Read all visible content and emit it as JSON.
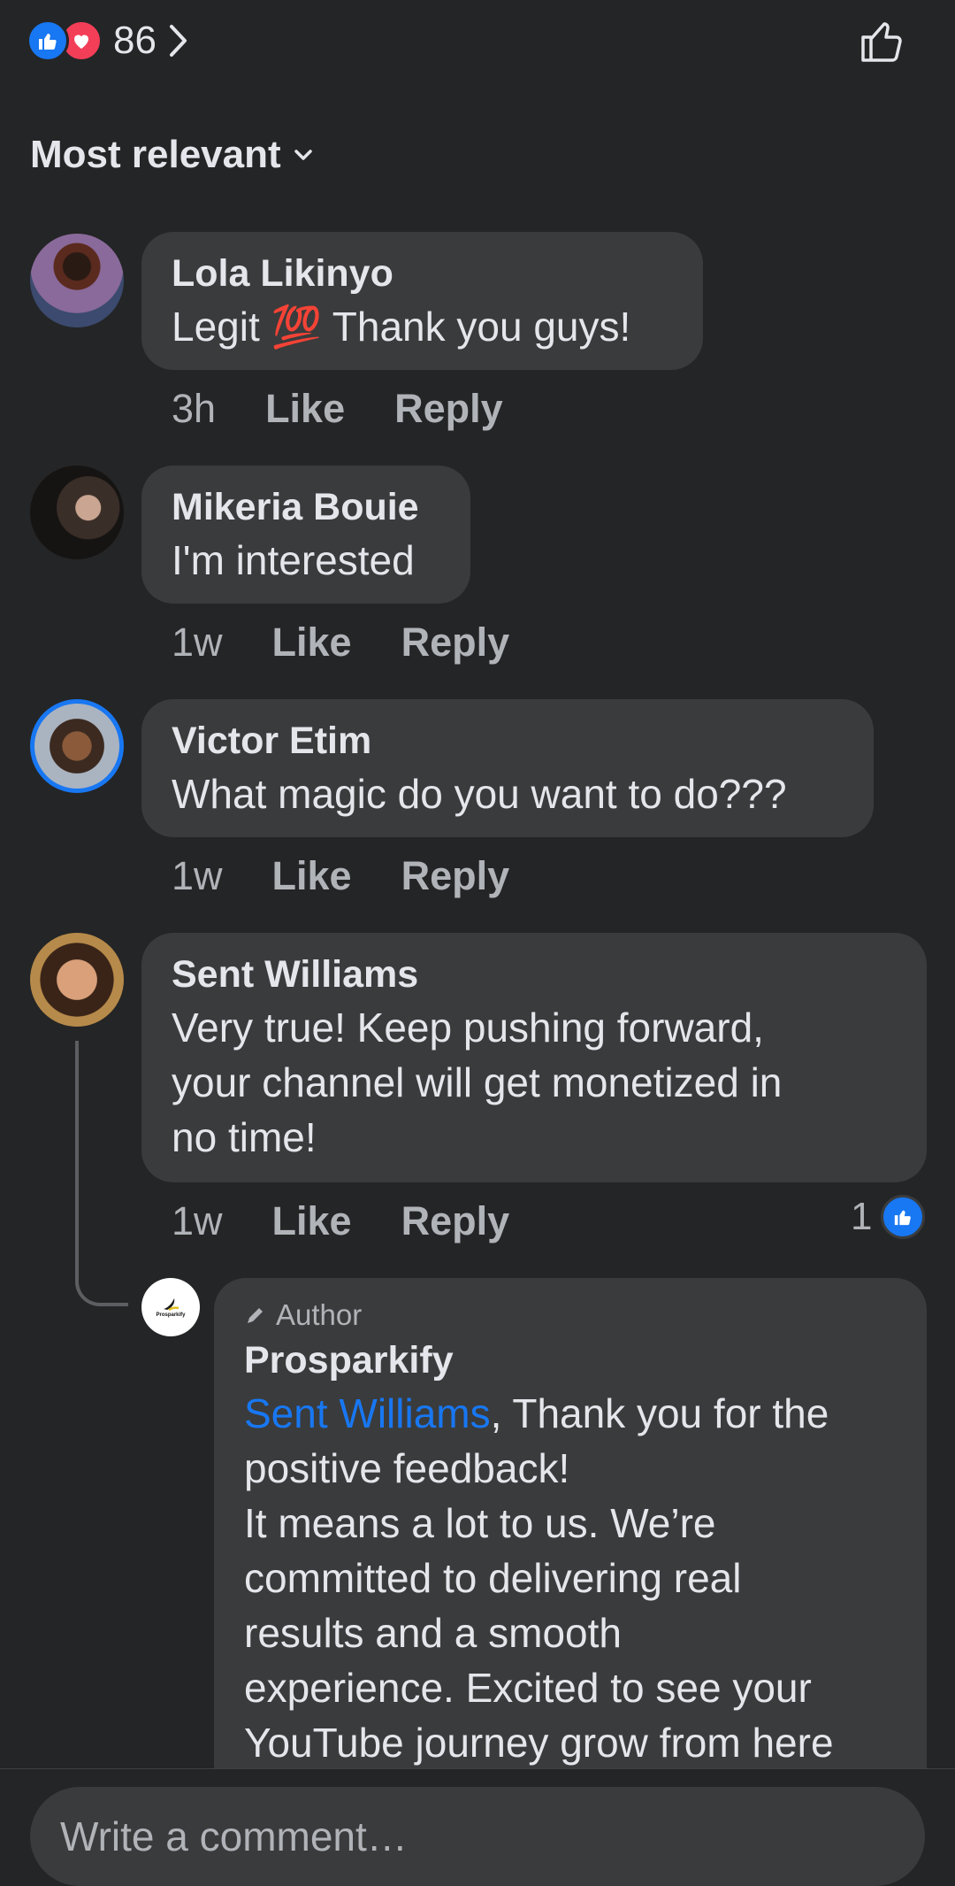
{
  "reactions": {
    "count": "86",
    "types": [
      "like",
      "love"
    ],
    "colors": {
      "like": "#1877f2",
      "love": "#f33e58"
    }
  },
  "sort": {
    "label": "Most relevant"
  },
  "comments": [
    {
      "name": "Lola Likinyo",
      "text_before": "Legit ",
      "emoji": "💯",
      "text_after": " Thank you guys!",
      "time": "3h",
      "like": "Like",
      "reply": "Reply"
    },
    {
      "name": "Mikeria Bouie",
      "text": "I'm interested",
      "time": "1w",
      "like": "Like",
      "reply": "Reply"
    },
    {
      "name": "Victor Etim",
      "text": "What magic do you want to do???",
      "time": "1w",
      "like": "Like",
      "reply": "Reply"
    },
    {
      "name": "Sent Williams",
      "lines": [
        "Very true! Keep pushing forward,",
        "your channel will get monetized in",
        "no time!"
      ],
      "time": "1w",
      "like": "Like",
      "reply": "Reply",
      "reactions": "1"
    }
  ],
  "reply": {
    "badge": "Author",
    "name": "Prosparkify",
    "avatar_text": "Prosparkify",
    "mention": "Sent Williams",
    "lines": [
      ", Thank you for the",
      "positive feedback!",
      "It means a lot to us. We’re",
      "committed to delivering real",
      "results and a smooth",
      "experience. Excited to see your",
      "YouTube journey grow from here"
    ]
  },
  "composer": {
    "placeholder": "Write a comment…"
  }
}
